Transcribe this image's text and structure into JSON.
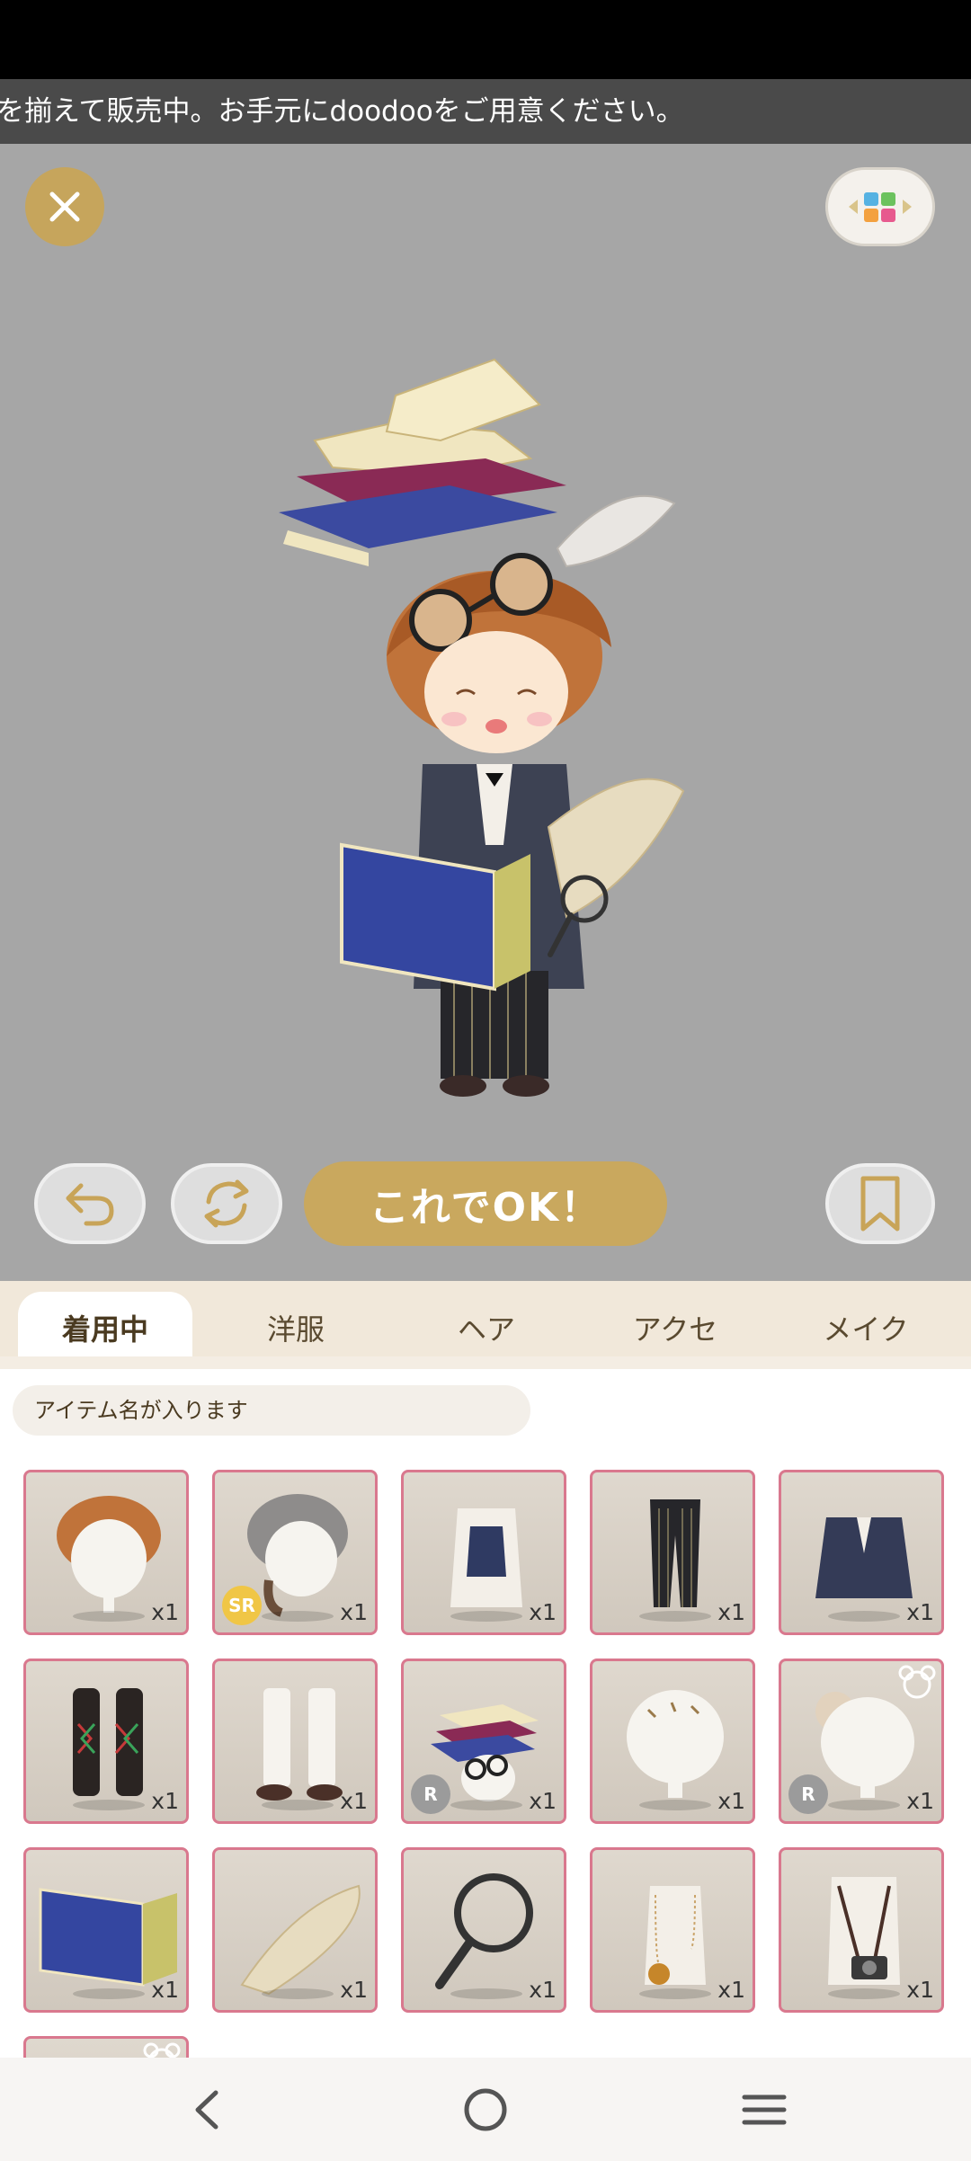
{
  "ticker": {
    "text": "を揃えて販売中。お手元にdoodooをご用意ください。"
  },
  "actions": {
    "ok_label": "これでOK！"
  },
  "tabs": [
    {
      "label": "着用中",
      "active": true
    },
    {
      "label": "洋服",
      "active": false
    },
    {
      "label": "ヘア",
      "active": false
    },
    {
      "label": "アクセ",
      "active": false
    },
    {
      "label": "メイク",
      "active": false
    }
  ],
  "search": {
    "placeholder": "アイテム名が入ります"
  },
  "items": [
    {
      "name": "brown-hair",
      "count": "x1"
    },
    {
      "name": "gray-hair",
      "count": "x1",
      "rarity": "SR"
    },
    {
      "name": "navy-vest",
      "count": "x1"
    },
    {
      "name": "striped-pants",
      "count": "x1"
    },
    {
      "name": "navy-jacket",
      "count": "x1"
    },
    {
      "name": "argyle-socks",
      "count": "x1"
    },
    {
      "name": "white-boots",
      "count": "x1"
    },
    {
      "name": "book-stack-hat",
      "count": "x1",
      "rarity": "R"
    },
    {
      "name": "hair-pins",
      "count": "x1"
    },
    {
      "name": "bun-accessory",
      "count": "x1",
      "rarity": "R"
    },
    {
      "name": "blue-book",
      "count": "x1"
    },
    {
      "name": "map-scroll",
      "count": "x1"
    },
    {
      "name": "magnifying-glass",
      "count": "x1"
    },
    {
      "name": "pendant-necklace",
      "count": "x1"
    },
    {
      "name": "camera-strap",
      "count": "x1"
    }
  ],
  "colors": {
    "accent": "#c9a85e",
    "item_border": "#d9788e",
    "stage_bg": "#a6a6a6",
    "tab_bg": "#f1e8da"
  }
}
